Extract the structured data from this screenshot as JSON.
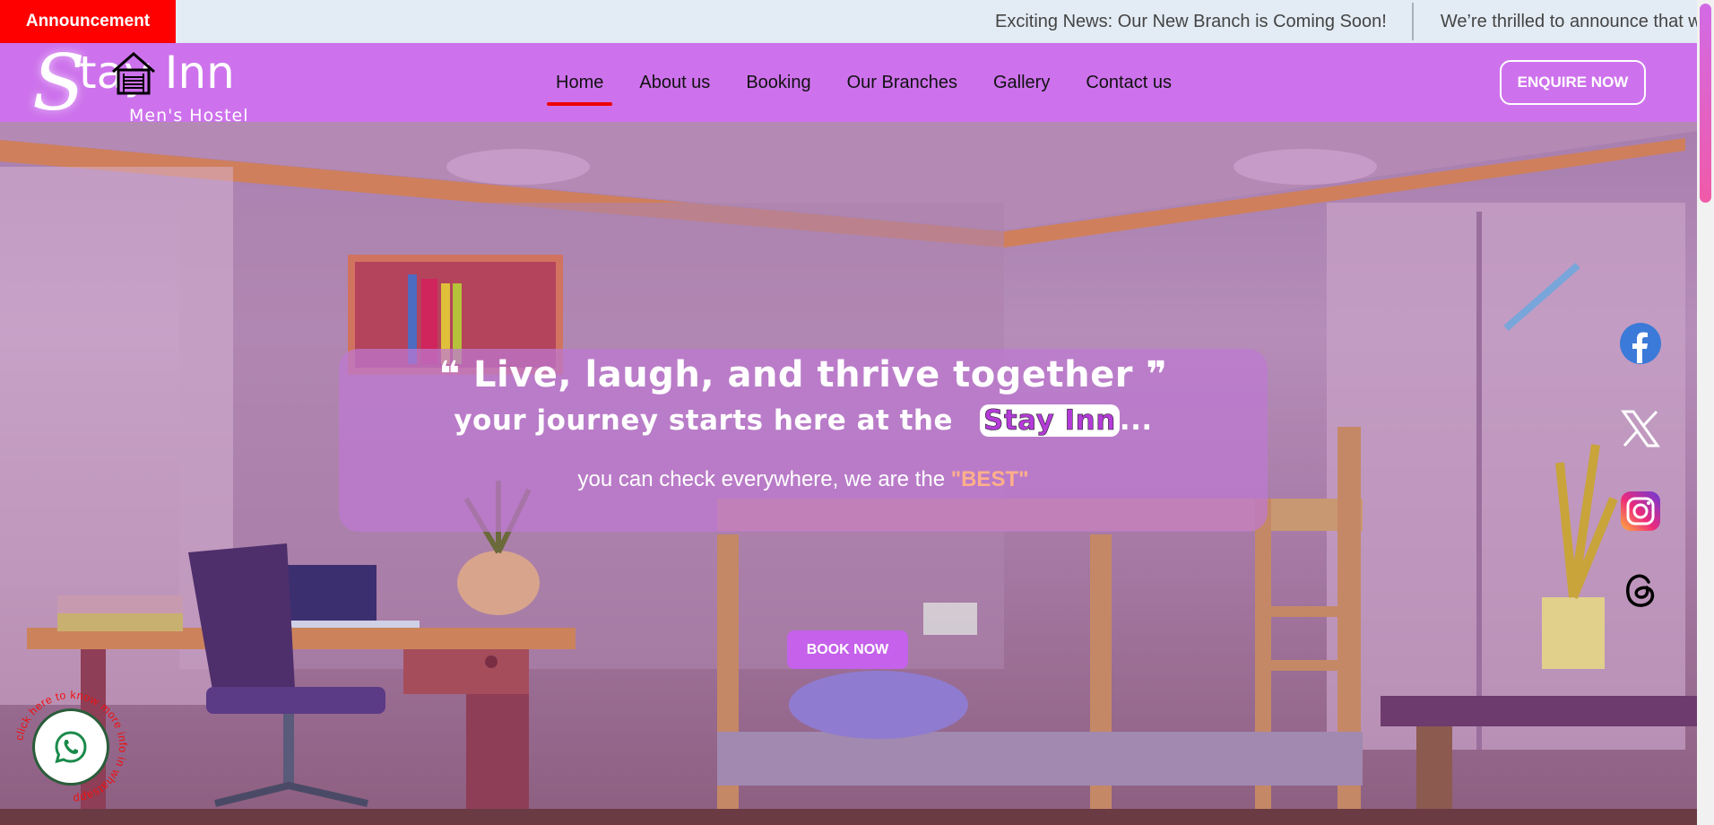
{
  "announcement": {
    "label": "Announcement",
    "messages": [
      "Exciting News: Our New Branch is Coming Soon!",
      "We’re thrilled to announce that we"
    ]
  },
  "brand": {
    "name_first_letter": "S",
    "name_rest": "tay Inn",
    "subtitle": "Men's Hostel"
  },
  "nav": {
    "items": [
      "Home",
      "About us",
      "Booking",
      "Our Branches",
      "Gallery",
      "Contact us"
    ],
    "active": "Home"
  },
  "enquire_label": "ENQUIRE NOW",
  "hero": {
    "quote_open": "❝",
    "quote_text": "Live, laugh, and thrive together",
    "quote_close": "❞",
    "line2_prefix": "your journey starts here at the",
    "line2_highlight": "Stay Inn",
    "line2_suffix": "...",
    "line3_prefix": "you can check everywhere, we are the",
    "line3_emphasis": "\"BEST\"",
    "book_label": "BOOK NOW"
  },
  "social": [
    "facebook-icon",
    "x-icon",
    "instagram-icon",
    "threads-icon"
  ],
  "whatsapp": {
    "circle_text": "click here to know more info in whatsapp"
  },
  "colors": {
    "announcement_red": "#ff0000",
    "nav_purple": "#cd72ec",
    "button_purple": "#c561ea",
    "best_color": "#ffb08a"
  }
}
